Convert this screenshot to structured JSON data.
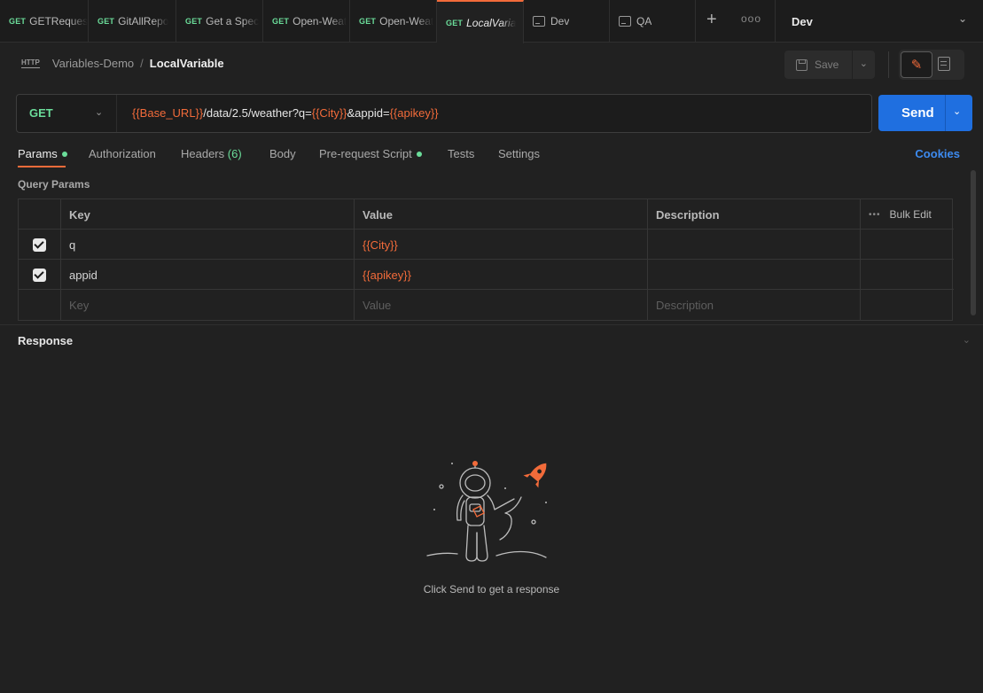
{
  "tabs": [
    {
      "method": "GET",
      "name": "GETRequest"
    },
    {
      "method": "GET",
      "name": "GitAllRepo"
    },
    {
      "method": "GET",
      "name": "Get a Spec"
    },
    {
      "method": "GET",
      "name": "Open-Weat"
    },
    {
      "method": "GET",
      "name": "Open-Weat"
    },
    {
      "method": "GET",
      "name": "LocalVaria"
    },
    {
      "icon": "environment-icon",
      "name": "Dev"
    },
    {
      "icon": "environment-icon",
      "name": "QA"
    }
  ],
  "tab_actions": {
    "new": "+",
    "more": "ooo"
  },
  "environment": {
    "selected": "Dev"
  },
  "breadcrumb": {
    "icon_label": "HTTP",
    "collection": "Variables-Demo",
    "separator": "/",
    "request": "LocalVariable"
  },
  "toolbar": {
    "save_label": "Save"
  },
  "request": {
    "method": "GET",
    "url_parts": {
      "var1": "{{Base_URL}}",
      "seg1": "/data/2.5/weather?q=",
      "var2": "{{City}}",
      "seg2": "&appid=",
      "var3": "{{apikey}}"
    }
  },
  "send": {
    "label": "Send"
  },
  "request_tabs": {
    "params": "Params",
    "authorization": "Authorization",
    "headers": "Headers",
    "headers_count": "(6)",
    "body": "Body",
    "prerequest": "Pre-request Script",
    "tests": "Tests",
    "settings": "Settings",
    "cookies": "Cookies"
  },
  "query_params": {
    "title": "Query Params",
    "headers": {
      "key": "Key",
      "value": "Value",
      "description": "Description",
      "more": "•••",
      "bulk_edit": "Bulk Edit"
    },
    "rows": [
      {
        "checked": true,
        "key": "q",
        "value": "{{City}}",
        "description": ""
      },
      {
        "checked": true,
        "key": "appid",
        "value": "{{apikey}}",
        "description": ""
      }
    ],
    "placeholders": {
      "key": "Key",
      "value": "Value",
      "description": "Description"
    }
  },
  "response": {
    "title": "Response",
    "empty_message": "Click Send to get a response"
  },
  "colors": {
    "accent": "#f26b3a",
    "method_get": "#6bdd9a",
    "primary_button": "#1f6fe0",
    "link": "#3d8bf0",
    "background": "#212121"
  }
}
